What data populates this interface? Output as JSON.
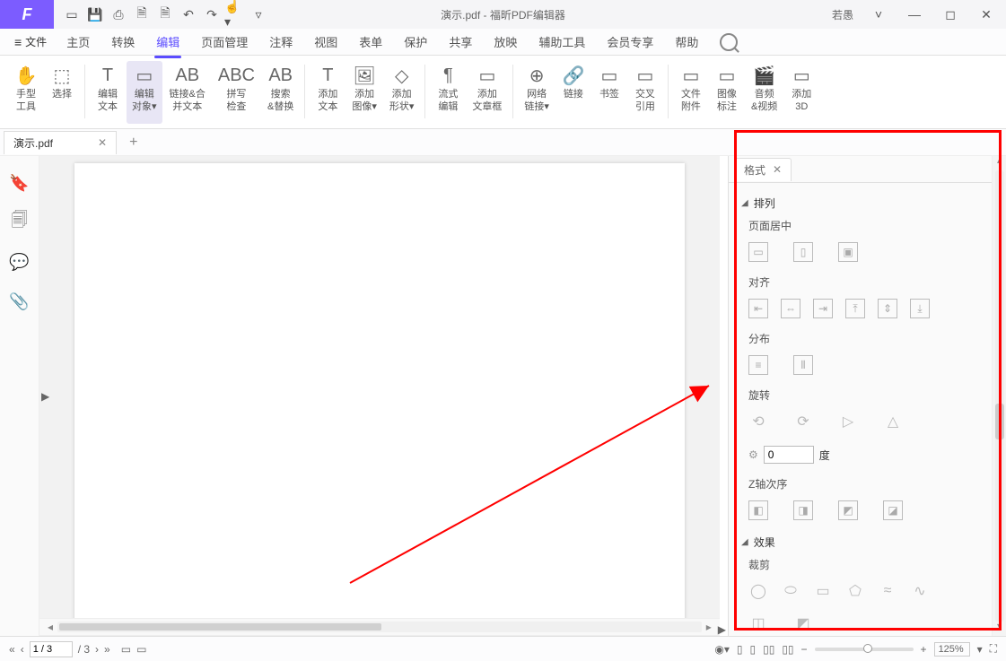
{
  "app": {
    "title": "演示.pdf - 福昕PDF编辑器",
    "user": "若愚"
  },
  "menutabs": [
    "主页",
    "转换",
    "编辑",
    "页面管理",
    "注释",
    "视图",
    "表单",
    "保护",
    "共享",
    "放映",
    "辅助工具",
    "会员专享",
    "帮助"
  ],
  "active_menu": "编辑",
  "file_label": "文件",
  "ribbon": [
    {
      "id": "hand",
      "label": "手型\n工具",
      "glyph": "✋"
    },
    {
      "id": "select",
      "label": "选择",
      "glyph": "⬚"
    },
    {
      "sep": true
    },
    {
      "id": "edit-text",
      "label": "编辑\n文本",
      "glyph": "T"
    },
    {
      "id": "edit-object",
      "label": "编辑\n对象▾",
      "glyph": "▭",
      "sel": true
    },
    {
      "id": "link-merge",
      "label": "链接&合\n并文本",
      "glyph": "AB"
    },
    {
      "id": "spell",
      "label": "拼写\n检查",
      "glyph": "ABC"
    },
    {
      "id": "find-replace",
      "label": "搜索\n&替换",
      "glyph": "AB"
    },
    {
      "sep": true
    },
    {
      "id": "add-text",
      "label": "添加\n文本",
      "glyph": "T"
    },
    {
      "id": "add-image",
      "label": "添加\n图像▾",
      "glyph": "🖼"
    },
    {
      "id": "add-shape",
      "label": "添加\n形状▾",
      "glyph": "◇"
    },
    {
      "sep": true
    },
    {
      "id": "reflow",
      "label": "流式\n编辑",
      "glyph": "¶"
    },
    {
      "id": "add-article",
      "label": "添加\n文章框",
      "glyph": "▭"
    },
    {
      "sep": true
    },
    {
      "id": "weblink",
      "label": "网络\n链接▾",
      "glyph": "⊕"
    },
    {
      "id": "link",
      "label": "链接",
      "glyph": "🔗"
    },
    {
      "id": "bookmark",
      "label": "书签",
      "glyph": "▭"
    },
    {
      "id": "xref",
      "label": "交叉\n引用",
      "glyph": "▭"
    },
    {
      "sep": true
    },
    {
      "id": "attach",
      "label": "文件\n附件",
      "glyph": "▭"
    },
    {
      "id": "image-flag",
      "label": "图像\n标注",
      "glyph": "▭"
    },
    {
      "id": "av",
      "label": "音频\n&视频",
      "glyph": "🎬"
    },
    {
      "id": "add3d",
      "label": "添加\n3D",
      "glyph": "▭"
    }
  ],
  "doc_tab": "演示.pdf",
  "panel": {
    "tab": "格式",
    "arrange": "排列",
    "page_center": "页面居中",
    "align": "对齐",
    "distribute": "分布",
    "rotate": "旋转",
    "deg_unit": "度",
    "deg_value": "0",
    "zorder": "Z轴次序",
    "effect": "效果",
    "crop": "裁剪"
  },
  "status": {
    "page": "1 / 3",
    "total": "/ 3",
    "zoom": "125%"
  }
}
